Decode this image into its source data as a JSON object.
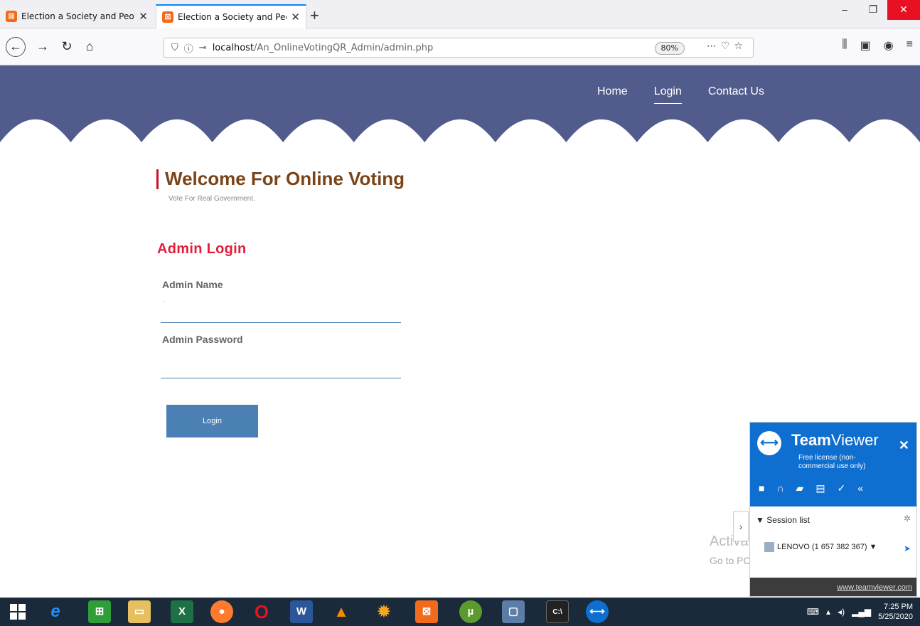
{
  "browser": {
    "tabs": [
      {
        "title": "Election a Society and People",
        "active": false
      },
      {
        "title": "Election a Society and People C",
        "active": true
      }
    ],
    "url_host": "localhost",
    "url_path": "/An_OnlineVotingQR_Admin/admin.php",
    "zoom": "80%"
  },
  "site": {
    "nav": [
      "Home",
      "Login",
      "Contact Us"
    ],
    "active_nav": "Login",
    "header_color": "#515c8c",
    "welcome_title": "Welcome For Online Voting",
    "welcome_subtitle": "Vote For Real Government.",
    "admin_login_title": "Admin Login",
    "admin_name_label": "Admin Name",
    "admin_name_placeholder": ".",
    "admin_password_label": "Admin Password",
    "login_button": "Login"
  },
  "watermark": {
    "title": "Activate Windows",
    "subtitle": "Go to PC settings to activate Windows."
  },
  "teamviewer": {
    "brand_bold": "Team",
    "brand_rest": "Viewer",
    "license": "Free license (non-commercial use only)",
    "session_list": "▼ Session list",
    "device": "LENOVO (1 657 382 367) ▼",
    "link": "www.teamviewer.com"
  },
  "taskbar": {
    "time": "7:25 PM",
    "date": "5/25/2020"
  }
}
